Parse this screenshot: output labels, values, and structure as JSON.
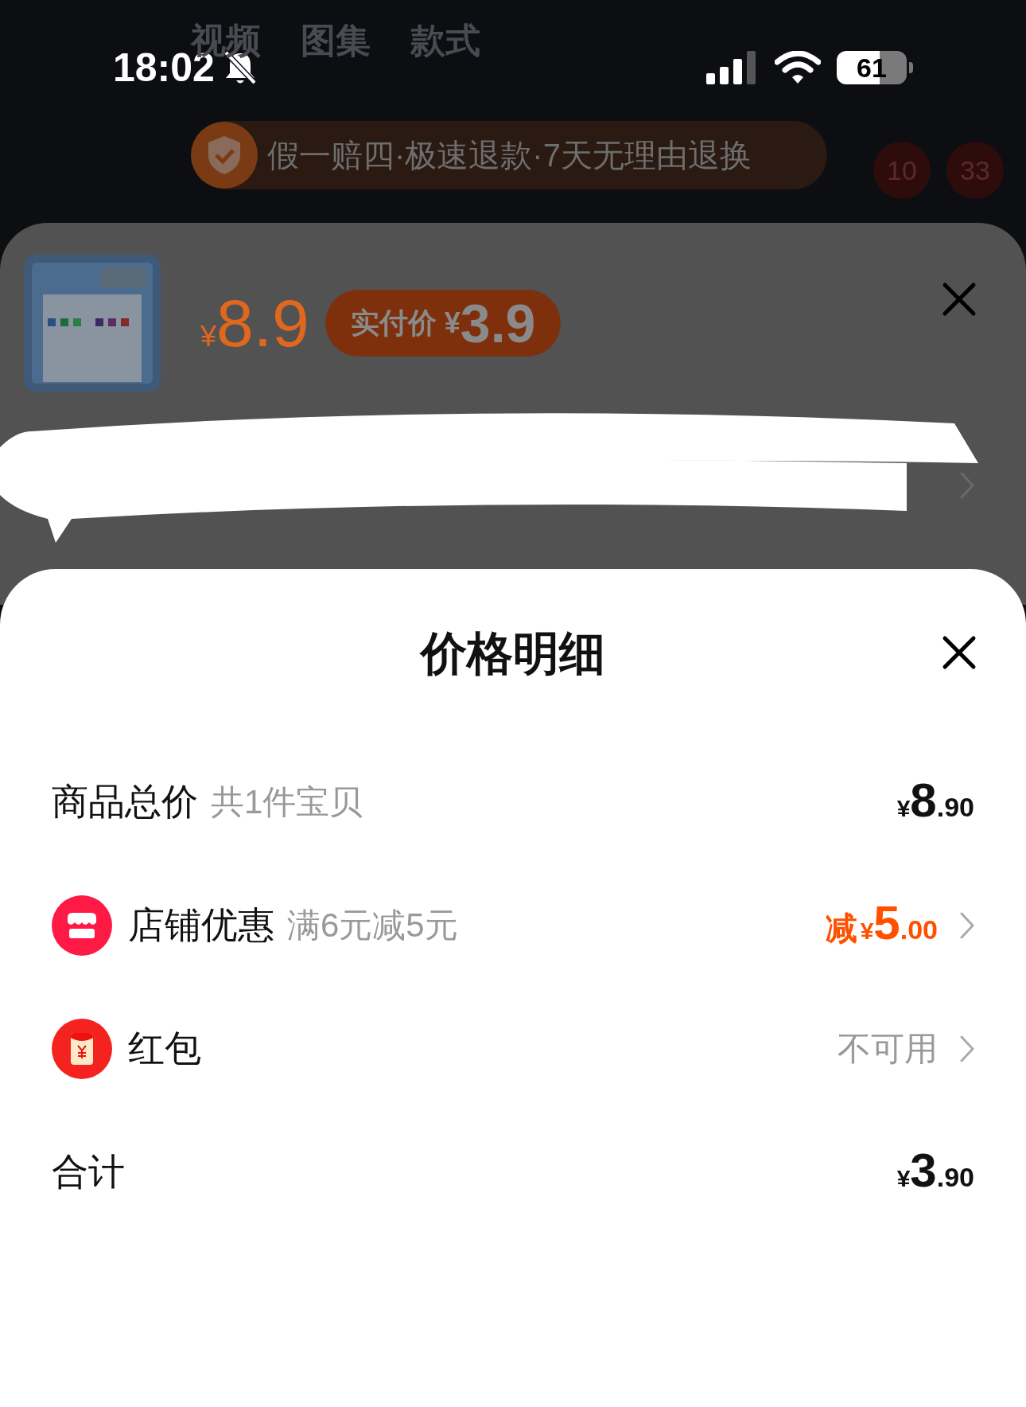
{
  "status_bar": {
    "time": "18:02",
    "battery": "61"
  },
  "background_page": {
    "tabs": [
      "视频",
      "图集",
      "款式"
    ],
    "guarantee_banner": "假一赔四·极速退款·7天无理由退换",
    "badges": [
      "10",
      "33"
    ]
  },
  "sku_sheet": {
    "price_symbol": "¥",
    "price": "8.9",
    "actual_price_label": "实付价",
    "actual_price_symbol": "¥",
    "actual_price": "3.9"
  },
  "price_detail": {
    "title": "价格明细",
    "rows": [
      {
        "kind": "plain",
        "label": "商品总价",
        "note": "共1件宝贝",
        "symbol": "¥",
        "integer": "8",
        "decimal": ".90",
        "chevron": false
      },
      {
        "kind": "shop",
        "label": "店铺优惠",
        "note": "满6元减5元",
        "prefix": "减",
        "symbol": "¥",
        "integer": "5",
        "decimal": ".00",
        "chevron": true
      },
      {
        "kind": "red_packet",
        "label": "红包",
        "status": "不可用",
        "chevron": true
      },
      {
        "kind": "plain",
        "label": "合计",
        "symbol": "¥",
        "integer": "3",
        "decimal": ".90",
        "chevron": false
      }
    ]
  }
}
